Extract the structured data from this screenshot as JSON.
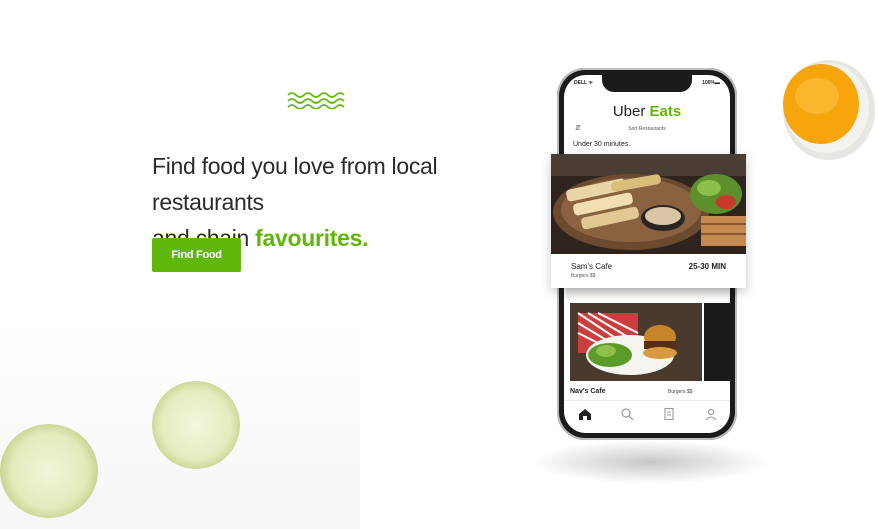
{
  "hero": {
    "headline_line1": "Find food you love from local restaurants",
    "headline_line2_prefix": "and chain ",
    "headline_accent": "favourites.",
    "cta_label": "Find Food"
  },
  "phone": {
    "status_left": "DELL ᯤ",
    "status_right": "100%▬",
    "logo_uber": "Uber ",
    "logo_eats": "Eats",
    "filter_icon": "sliders-icon",
    "sort_label": "Sort Restaurants",
    "section_title": "Under 30 minutes.",
    "featured": {
      "name": "Sam's Cafe",
      "category": "Burgers $$",
      "time": "25-30 MIN"
    },
    "second": {
      "name": "Nav's Cafe",
      "category": "Burgers $$"
    },
    "tabs": [
      "home-icon",
      "search-icon",
      "orders-icon",
      "profile-icon"
    ]
  },
  "colors": {
    "brand_green": "#5fb709",
    "text_dark": "#2b2b2b"
  }
}
